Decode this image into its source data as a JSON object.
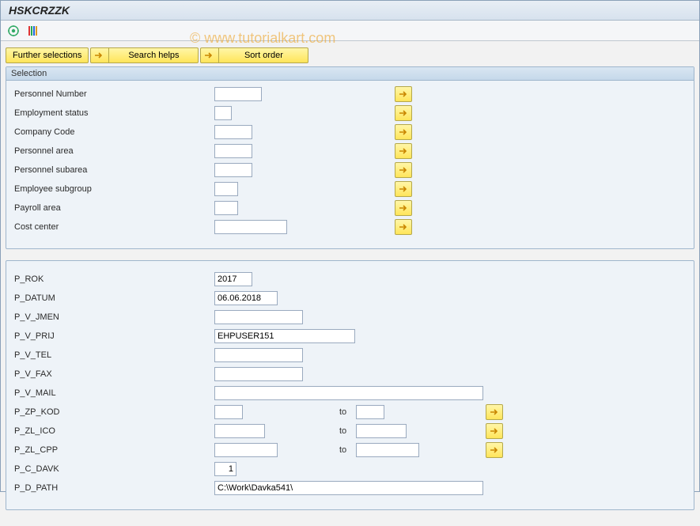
{
  "title": "HSKCRZZK",
  "watermark": "© www.tutorialkart.com",
  "buttons": {
    "further": "Further selections",
    "searchHelps": "Search helps",
    "sortOrder": "Sort order"
  },
  "selection": {
    "header": "Selection",
    "fields": {
      "pernr_label": "Personnel Number",
      "empstat_label": "Employment status",
      "ccode_label": "Company Code",
      "parea_label": "Personnel area",
      "psub_label": "Personnel subarea",
      "esub_label": "Employee subgroup",
      "payroll_label": "Payroll area",
      "cost_label": "Cost center",
      "pernr": "",
      "empstat": "",
      "ccode": "",
      "parea": "",
      "psub": "",
      "esub": "",
      "payroll": "",
      "cost": ""
    }
  },
  "params": {
    "p_rok_label": "P_ROK",
    "p_rok": "2017",
    "p_datum_label": "P_DATUM",
    "p_datum": "06.06.2018",
    "p_v_jmen_label": "P_V_JMEN",
    "p_v_jmen": "",
    "p_v_prij_label": "P_V_PRIJ",
    "p_v_prij": "EHPUSER151",
    "p_v_tel_label": "P_V_TEL",
    "p_v_tel": "",
    "p_v_fax_label": "P_V_FAX",
    "p_v_fax": "",
    "p_v_mail_label": "P_V_MAIL",
    "p_v_mail": "",
    "p_zp_kod_label": "P_ZP_KOD",
    "p_zp_kod_lo": "",
    "p_zp_kod_hi": "",
    "p_zl_ico_label": "P_ZL_ICO",
    "p_zl_ico_lo": "",
    "p_zl_ico_hi": "",
    "p_zl_cpp_label": "P_ZL_CPP",
    "p_zl_cpp_lo": "",
    "p_zl_cpp_hi": "",
    "p_c_davk_label": "P_C_DAVK",
    "p_c_davk": "1",
    "p_d_path_label": "P_D_PATH",
    "p_d_path": "C:\\Work\\Davka541\\",
    "to": "to"
  }
}
